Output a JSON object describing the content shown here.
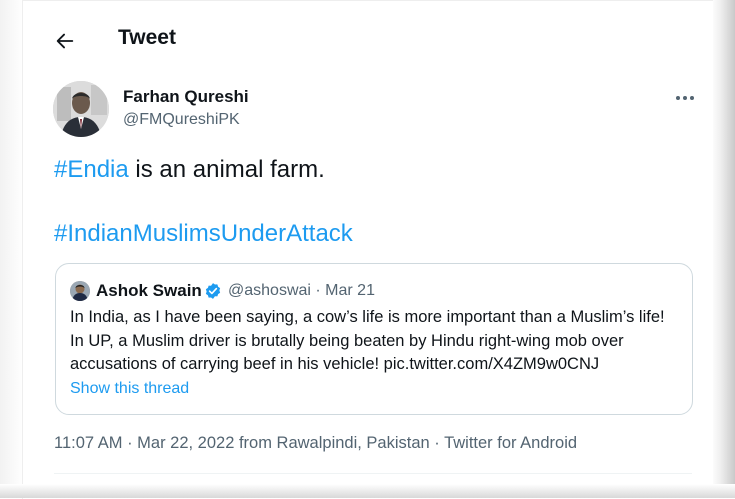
{
  "header": {
    "back_icon": "arrow-left-icon",
    "title": "Tweet"
  },
  "tweet": {
    "author_name": "Farhan Qureshi",
    "author_handle": "@FMQureshiPK",
    "more_icon": "more-horizontal-icon",
    "line1_hashtag": "#Endia",
    "line1_text": " is an animal farm.",
    "line2_hashtag": "#IndianMuslimsUnderAttack",
    "meta": "11:07 AM · Mar 22, 2022 from Rawalpindi, Pakistan · Twitter for Android"
  },
  "quote": {
    "author_name": "Ashok Swain",
    "verified_icon": "verified-badge-icon",
    "handle_date": "@ashoswai · Mar 21",
    "text": "In India, as I have been saying, a cow’s life is more important than a Muslim’s life! In UP, a Muslim driver is brutally being beaten by Hindu right-wing mob over accusations of carrying beef in his vehicle! pic.twitter.com/X4ZM9w0CNJ",
    "show_thread": "Show this thread"
  },
  "colors": {
    "link": "#1d9bf0",
    "secondary_text": "#536471",
    "primary_text": "#0f1419",
    "border": "#cfd9de"
  }
}
